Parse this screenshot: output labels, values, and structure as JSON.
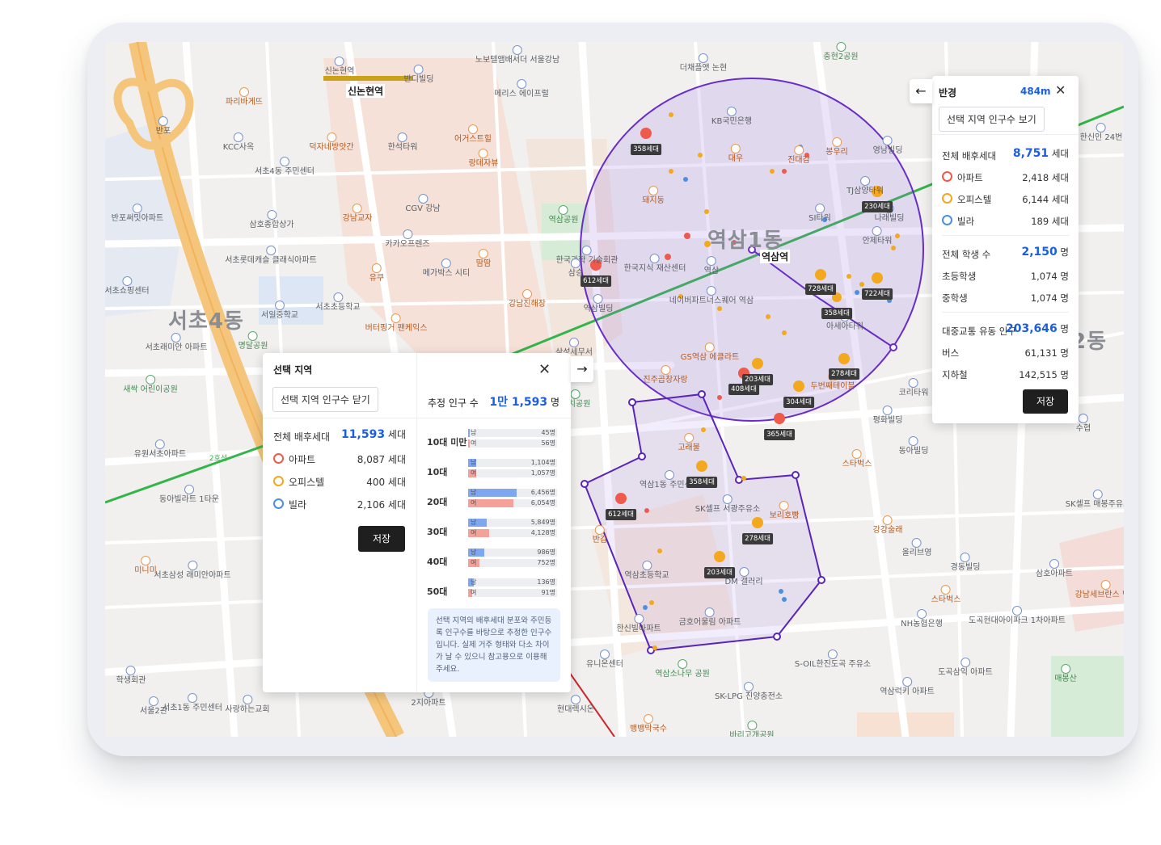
{
  "map": {
    "districts": [
      "서초4동",
      "역삼1동",
      "2동"
    ],
    "stations": [
      "신논현역",
      "역삼역"
    ],
    "pois": [
      {
        "name": "신논현역",
        "style": "b"
      },
      {
        "name": "노보텔앰배서더 서울강남",
        "style": "b"
      },
      {
        "name": "반디빌딩",
        "style": "b"
      },
      {
        "name": "파리바게뜨",
        "style": "o"
      },
      {
        "name": "반포",
        "style": "b"
      },
      {
        "name": "KCC사옥",
        "style": "b"
      },
      {
        "name": "덕자네방앗간",
        "style": "o"
      },
      {
        "name": "한석타워",
        "style": "b"
      },
      {
        "name": "어거스트힐",
        "style": "o"
      },
      {
        "name": "메리스 에이프럴",
        "style": "b"
      },
      {
        "name": "랑데자뷰",
        "style": "o"
      },
      {
        "name": "더채플앳 논현",
        "style": "b"
      },
      {
        "name": "충현2공원",
        "style": "g"
      },
      {
        "name": "서초4동 주민센터",
        "style": "b"
      },
      {
        "name": "반포써밋아파트",
        "style": "b"
      },
      {
        "name": "삼호종합상가",
        "style": "b"
      },
      {
        "name": "강남교자",
        "style": "o"
      },
      {
        "name": "CGV 강남",
        "style": "b"
      },
      {
        "name": "역삼공원",
        "style": "g"
      },
      {
        "name": "카카오프렌즈",
        "style": "b"
      },
      {
        "name": "서초롯데캐슬 클래식아파트",
        "style": "b"
      },
      {
        "name": "유쿠",
        "style": "o"
      },
      {
        "name": "메가박스 시티",
        "style": "b"
      },
      {
        "name": "땀땀",
        "style": "o"
      },
      {
        "name": "한국과학 기술회관",
        "style": "b"
      },
      {
        "name": "서초쇼핑센터",
        "style": "b"
      },
      {
        "name": "서일중학교",
        "style": "b"
      },
      {
        "name": "서초초등학교",
        "style": "b"
      },
      {
        "name": "강남진해장",
        "style": "o"
      },
      {
        "name": "버터핑거 팬케익스",
        "style": "o"
      },
      {
        "name": "역삼빌딩",
        "style": "b"
      },
      {
        "name": "서초래미안 아파트",
        "style": "b"
      },
      {
        "name": "명달공원",
        "style": "g"
      },
      {
        "name": "삼성세무서",
        "style": "b"
      },
      {
        "name": "새싹 어린이공원",
        "style": "g"
      },
      {
        "name": "유원서초아파트",
        "style": "b"
      },
      {
        "name": "동아빌라트 1타운",
        "style": "b"
      },
      {
        "name": "미니미",
        "style": "o"
      },
      {
        "name": "서초삼성 래미안아파트",
        "style": "b"
      },
      {
        "name": "학생회관",
        "style": "b"
      },
      {
        "name": "서초1동 주민센터",
        "style": "b"
      },
      {
        "name": "사랑하는교회",
        "style": "b"
      },
      {
        "name": "서울2관",
        "style": "b"
      },
      {
        "name": "2지아파트",
        "style": "b"
      },
      {
        "name": "현대렉시온",
        "style": "b"
      },
      {
        "name": "뱅뱅막국수",
        "style": "o"
      },
      {
        "name": "유니온센터",
        "style": "b"
      },
      {
        "name": "역삼소나무 공원",
        "style": "g"
      },
      {
        "name": "KB국민은행",
        "style": "b"
      },
      {
        "name": "대우",
        "style": "o"
      },
      {
        "name": "봉우리",
        "style": "o"
      },
      {
        "name": "진대감",
        "style": "o"
      },
      {
        "name": "영남빌딩",
        "style": "b"
      },
      {
        "name": "돼지동",
        "style": "o"
      },
      {
        "name": "TJ삼양타워",
        "style": "b"
      },
      {
        "name": "SI타워",
        "style": "b"
      },
      {
        "name": "한국지식 재산센터",
        "style": "b"
      },
      {
        "name": "네이버파트너스퀘어 역삼",
        "style": "b"
      },
      {
        "name": "GS역삼 에클라트",
        "style": "o"
      },
      {
        "name": "진주곱창자랑",
        "style": "o"
      },
      {
        "name": "두번째테이블",
        "style": "o"
      },
      {
        "name": "평화빌딩",
        "style": "b"
      },
      {
        "name": "동아빌딩",
        "style": "b"
      },
      {
        "name": "스타벅스",
        "style": "o"
      },
      {
        "name": "고래불",
        "style": "o"
      },
      {
        "name": "역삼1동 주민센터",
        "style": "b"
      },
      {
        "name": "SK셀프 서광주유소",
        "style": "b"
      },
      {
        "name": "보리호빵",
        "style": "o"
      },
      {
        "name": "강강술래",
        "style": "o"
      },
      {
        "name": "올리브영",
        "style": "b"
      },
      {
        "name": "경동빌딩",
        "style": "b"
      },
      {
        "name": "삼호아파트",
        "style": "b"
      },
      {
        "name": "역삼초등학교",
        "style": "b"
      },
      {
        "name": "금호어울림 아파트",
        "style": "b"
      },
      {
        "name": "DM 갤러리",
        "style": "b"
      },
      {
        "name": "한신빌아파트",
        "style": "b"
      },
      {
        "name": "S-OIL한진도곡 주유소",
        "style": "b"
      },
      {
        "name": "SK-LPG 진양충전소",
        "style": "b"
      },
      {
        "name": "NH농협은행",
        "style": "b"
      },
      {
        "name": "스타벅스",
        "style": "o"
      },
      {
        "name": "도곡현대아이파크 1차아파트",
        "style": "b"
      },
      {
        "name": "강남세브란스 병원",
        "style": "o"
      },
      {
        "name": "도곡삼익 아파트",
        "style": "b"
      },
      {
        "name": "역삼럭키 아파트",
        "style": "b"
      },
      {
        "name": "매봉산",
        "style": "g"
      },
      {
        "name": "SK셀프 매봉주유소",
        "style": "b"
      },
      {
        "name": "수협",
        "style": "b"
      },
      {
        "name": "한신인 24번",
        "style": "b"
      },
      {
        "name": "바리고개공원",
        "style": "g"
      },
      {
        "name": "반감",
        "style": "o"
      },
      {
        "name": "까치공원",
        "style": "g"
      },
      {
        "name": "나래빌딩",
        "style": "b"
      },
      {
        "name": "안제타워",
        "style": "b"
      },
      {
        "name": "아세아타워",
        "style": "b"
      },
      {
        "name": "코리타워",
        "style": "b"
      },
      {
        "name": "역삼",
        "style": "b"
      },
      {
        "name": "삼승",
        "style": "b"
      }
    ],
    "tags": [
      "358세대",
      "230세대",
      "612세대",
      "728세대",
      "722세대",
      "358세대",
      "278세대",
      "203세대",
      "408세대",
      "304세대",
      "365세대",
      "358세대",
      "612세대",
      "278세대",
      "203세대"
    ],
    "road_label": "2호선"
  },
  "left_panel": {
    "title": "선택 지역",
    "toggle_btn": "선택 지역 인구수 닫기",
    "total_label": "전체 배후세대",
    "total_value": "11,593",
    "total_unit": "세대",
    "rows": [
      {
        "label": "아파트",
        "value": "8,087 세대",
        "color": "#ef5a4c"
      },
      {
        "label": "오피스텔",
        "value": "400 세대",
        "color": "#f4a81e"
      },
      {
        "label": "빌라",
        "value": "2,106 세대",
        "color": "#4b8fe3"
      }
    ],
    "save": "저장",
    "pop_label": "추정 인구 수",
    "pop_value": "1만 1,593",
    "pop_unit": "명",
    "male_short": "남",
    "female_short": "여",
    "ages": [
      {
        "label": "10대 미만",
        "male": "45명",
        "female": "56명",
        "male_frac": 0.006,
        "female_frac": 0.009
      },
      {
        "label": "10대",
        "male": "1,104명",
        "female": "1,057명",
        "male_frac": 0.17,
        "female_frac": 0.16
      },
      {
        "label": "20대",
        "male": "6,456명",
        "female": "6,054명",
        "male_frac": 1.0,
        "female_frac": 0.94
      },
      {
        "label": "30대",
        "male": "5,849명",
        "female": "4,128명",
        "male_frac": 0.38,
        "female_frac": 0.44
      },
      {
        "label": "40대",
        "male": "986명",
        "female": "752명",
        "male_frac": 0.34,
        "female_frac": 0.24
      },
      {
        "label": "50대",
        "male": "136명",
        "female": "91명",
        "male_frac": 0.11,
        "female_frac": 0.08
      }
    ],
    "note": "선택 지역의 배후세대 분포와 주민등록 인구수를 바탕으로 추정한 인구수입니다. 실제 거주 형태와 다소 차이가 날 수 있으니 참고용으로 이용해 주세요."
  },
  "right_panel": {
    "title": "반경",
    "radius": "484m",
    "view_btn": "선택 지역 인구수 보기",
    "total_label": "전체 배후세대",
    "total_value": "8,751",
    "total_unit": "세대",
    "rows": [
      {
        "label": "아파트",
        "value": "2,418 세대",
        "color": "#ef5a4c"
      },
      {
        "label": "오피스텔",
        "value": "6,144 세대",
        "color": "#f4a81e"
      },
      {
        "label": "빌라",
        "value": "189 세대",
        "color": "#4b8fe3"
      }
    ],
    "student_label": "전체 학생 수",
    "student_value": "2,150",
    "student_unit": "명",
    "student_rows": [
      {
        "label": "초등학생",
        "value": "1,074 명"
      },
      {
        "label": "중학생",
        "value": "1,074 명"
      }
    ],
    "transit_label": "대중교통 유동 인구",
    "transit_value": "203,646",
    "transit_unit": "명",
    "transit_rows": [
      {
        "label": "버스",
        "value": "61,131 명"
      },
      {
        "label": "지하철",
        "value": "142,515 명"
      }
    ],
    "save": "저장"
  },
  "colors": {
    "accent": "#1a5fe0",
    "circle": "#6a2cc8",
    "apartment": "#ef5a4c",
    "officetel": "#f4a81e",
    "villa": "#4b8fe3"
  }
}
